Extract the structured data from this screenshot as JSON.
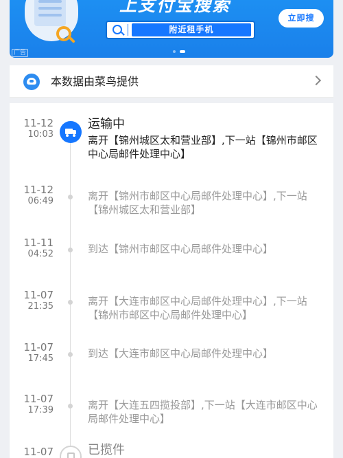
{
  "banner": {
    "slogan": "上支付宝搜索",
    "search_text": "附近租手机",
    "cta": "立即搜",
    "ad_label": "广告"
  },
  "provider": {
    "label": "本数据由菜鸟提供"
  },
  "events": [
    {
      "date": "11-12",
      "time": "10:03",
      "status": "运输中",
      "desc": "离开【锦州城区太和营业部】,下一站【锦州市邮区中心局邮件处理中心】"
    },
    {
      "date": "11-12",
      "time": "06:49",
      "desc": "离开【锦州市邮区中心局邮件处理中心】,下一站【锦州城区太和营业部】"
    },
    {
      "date": "11-11",
      "time": "04:52",
      "desc": "到达【锦州市邮区中心局邮件处理中心】"
    },
    {
      "date": "11-07",
      "time": "21:35",
      "desc": "离开【大连市邮区中心局邮件处理中心】,下一站【锦州市邮区中心局邮件处理中心】"
    },
    {
      "date": "11-07",
      "time": "17:45",
      "desc": "到达【大连市邮区中心局邮件处理中心】"
    },
    {
      "date": "11-07",
      "time": "17:39",
      "desc": "离开【大连五四揽投部】,下一站【大连市邮区中心局邮件处理中心】"
    },
    {
      "date": "11-07",
      "status": "已揽件"
    }
  ],
  "colors": {
    "accent": "#1677ff",
    "banner_bg": "#1a80ea",
    "text_primary": "#222222",
    "text_secondary": "#999999"
  },
  "icons": {
    "provider": "cainiao-logo-icon",
    "current_status": "truck-icon",
    "picked_status": "package-icon",
    "chevron": "chevron-right-icon"
  }
}
